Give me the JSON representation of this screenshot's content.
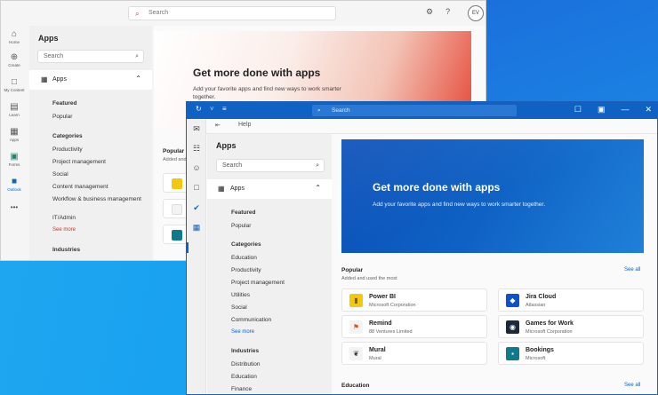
{
  "colors": {
    "accent": "#0f62c4",
    "brand_red": "#c4362b",
    "desktop": "#1a7be0"
  },
  "back_window": {
    "search_placeholder": "Search",
    "avatar": "EV",
    "rail": [
      {
        "icon": "home-icon",
        "label": "Home"
      },
      {
        "icon": "create-icon",
        "label": "Create"
      },
      {
        "icon": "folder-icon",
        "label": "My Content"
      },
      {
        "icon": "learn-icon",
        "label": "Learn"
      },
      {
        "icon": "apps-icon",
        "label": "Apps"
      },
      {
        "icon": "forms-icon",
        "label": "Forms"
      },
      {
        "icon": "outlook-icon",
        "label": "Outlook"
      }
    ],
    "more": "•••",
    "pane": {
      "title": "Apps",
      "search": "Search",
      "apps_label": "Apps",
      "featured": "Featured",
      "popular": "Popular",
      "categories_heading": "Categories",
      "categories": [
        "Productivity",
        "Project management",
        "Social",
        "Content management",
        "Workflow & business management",
        "IT/Admin"
      ],
      "see_more": "See more",
      "industries_heading": "Industries"
    },
    "hero": {
      "title": "Get more done with apps",
      "subtitle": "Add your favorite apps and find new ways to work smarter together."
    },
    "popular_title": "Popular",
    "popular_sub": "Added and"
  },
  "front_window": {
    "search_placeholder": "Search",
    "toolbar_label": "Help",
    "pane": {
      "title": "Apps",
      "search": "Search",
      "apps_label": "Apps",
      "featured": "Featured",
      "popular": "Popular",
      "categories_heading": "Categories",
      "categories": [
        "Education",
        "Productivity",
        "Project management",
        "Utilities",
        "Social",
        "Communication"
      ],
      "see_more": "See more",
      "industries_heading": "Industries",
      "industries": [
        "Distribution",
        "Education",
        "Finance"
      ]
    },
    "hero": {
      "title": "Get more done with apps",
      "subtitle": "Add your favorite apps and find new ways to work smarter together."
    },
    "popular": {
      "title": "Popular",
      "subtitle": "Added and used the most",
      "see_all": "See all",
      "apps": [
        {
          "name": "Power BI",
          "publisher": "Microsoft Corporation",
          "color": "#f2c811"
        },
        {
          "name": "Jira Cloud",
          "publisher": "Atlassian",
          "color": "#0b52cc"
        },
        {
          "name": "Remind",
          "publisher": "88 Ventures Limited",
          "color": "#f0f0f0"
        },
        {
          "name": "Games for Work",
          "publisher": "Microsoft Corporation",
          "color": "#1b2a3a"
        },
        {
          "name": "Mural",
          "publisher": "Mural",
          "color": "#f0f0f0"
        },
        {
          "name": "Bookings",
          "publisher": "Microsoft",
          "color": "#0e7a8c"
        }
      ]
    },
    "education": {
      "title": "Education",
      "see_all": "See all"
    }
  }
}
